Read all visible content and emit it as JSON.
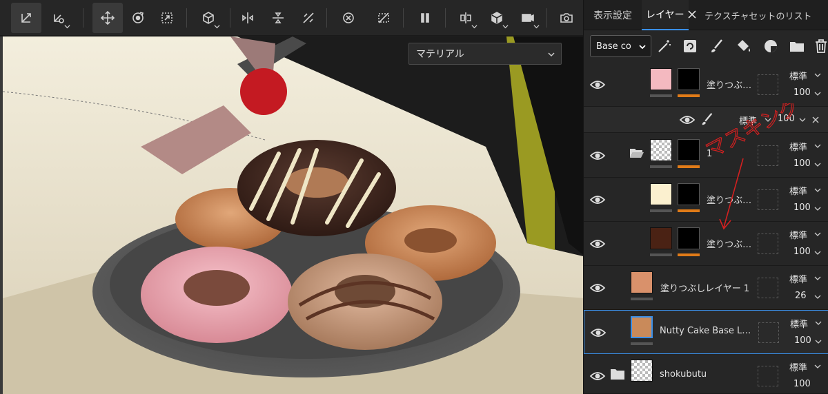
{
  "toolbar": {
    "buttons": [
      {
        "name": "transform-icon"
      },
      {
        "name": "transform-options-icon"
      },
      {
        "name": "move-icon"
      },
      {
        "name": "orbit-icon"
      },
      {
        "name": "fit-view-icon"
      },
      {
        "name": "cube-view-icon"
      },
      {
        "name": "mirror-x-icon"
      },
      {
        "name": "mirror-y-icon"
      },
      {
        "name": "mirror-diagonal-icon"
      },
      {
        "name": "reset-view-icon"
      },
      {
        "name": "hide-selection-icon"
      },
      {
        "name": "pause-icon"
      },
      {
        "name": "split-view-icon"
      },
      {
        "name": "3d-cube-icon"
      },
      {
        "name": "camera-icon"
      },
      {
        "name": "screenshot-icon"
      }
    ]
  },
  "viewport": {
    "material_dropdown": "マテリアル"
  },
  "panel": {
    "tabs": [
      {
        "label": "表示設定"
      },
      {
        "label": "レイヤー"
      },
      {
        "label": "テクスチャセットのリスト"
      }
    ],
    "blend_channel": "Base co",
    "layers": [
      {
        "name": "塗りつぶ…",
        "blend": "標準",
        "opacity": "100"
      },
      {
        "name": "1",
        "blend": "標準",
        "opacity": "100"
      },
      {
        "name": "塗りつぶ…",
        "blend": "標準",
        "opacity": "100"
      },
      {
        "name": "塗りつぶ…",
        "blend": "標準",
        "opacity": "100"
      },
      {
        "name": "塗りつぶしレイヤー 1",
        "blend": "標準",
        "opacity": "26"
      },
      {
        "name": "Nutty Cake Base L…",
        "blend": "標準",
        "opacity": "100"
      },
      {
        "name": "shokubutu",
        "blend": "標準",
        "opacity": "100"
      }
    ],
    "sub_effect": {
      "blend": "標準",
      "opacity": "100"
    },
    "handwritten_note": "マスキング"
  },
  "colors": {
    "accent": "#3a8fe8",
    "mask_bar": "#e07b18",
    "pink_fill": "#f4b9c0",
    "cream_fill": "#fbf0cf",
    "brown_fill": "#4a2214",
    "skin_fill": "#d9916b",
    "annotation": "#d42020"
  }
}
